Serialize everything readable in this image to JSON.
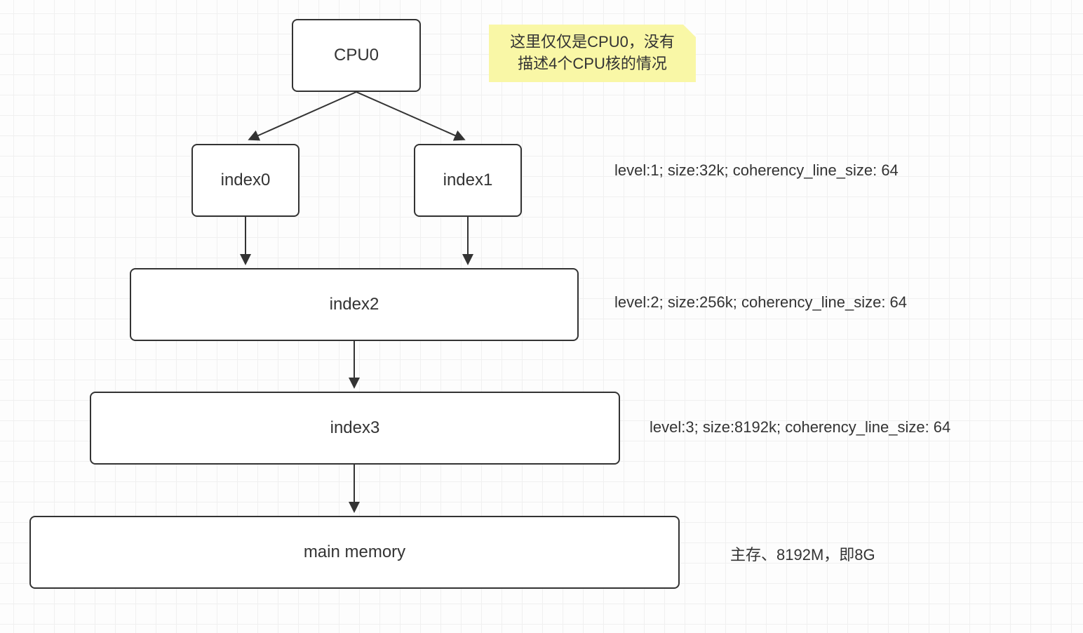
{
  "boxes": {
    "cpu0": "CPU0",
    "index0": "index0",
    "index1": "index1",
    "index2": "index2",
    "index3": "index3",
    "main_memory": "main memory"
  },
  "note": {
    "line1": "这里仅仅是CPU0，没有",
    "line2": "描述4个CPU核的情况"
  },
  "labels": {
    "level1": "level:1; size:32k; coherency_line_size: 64",
    "level2": "level:2; size:256k; coherency_line_size: 64",
    "level3": "level:3; size:8192k; coherency_line_size: 64",
    "main_memory": "主存、8192M，即8G"
  },
  "chart_data": {
    "type": "diagram",
    "description": "CPU cache hierarchy diagram for CPU0",
    "nodes": [
      {
        "id": "CPU0",
        "label": "CPU0"
      },
      {
        "id": "index0",
        "label": "index0",
        "level": 1,
        "size": "32k",
        "coherency_line_size": 64
      },
      {
        "id": "index1",
        "label": "index1",
        "level": 1,
        "size": "32k",
        "coherency_line_size": 64
      },
      {
        "id": "index2",
        "label": "index2",
        "level": 2,
        "size": "256k",
        "coherency_line_size": 64
      },
      {
        "id": "index3",
        "label": "index3",
        "level": 3,
        "size": "8192k",
        "coherency_line_size": 64
      },
      {
        "id": "main_memory",
        "label": "main memory",
        "size": "8192M",
        "size_note": "即8G"
      }
    ],
    "edges": [
      {
        "from": "CPU0",
        "to": "index0"
      },
      {
        "from": "CPU0",
        "to": "index1"
      },
      {
        "from": "index0",
        "to": "index2"
      },
      {
        "from": "index1",
        "to": "index2"
      },
      {
        "from": "index2",
        "to": "index3"
      },
      {
        "from": "index3",
        "to": "main_memory"
      }
    ],
    "annotation": "这里仅仅是CPU0，没有描述4个CPU核的情况"
  }
}
